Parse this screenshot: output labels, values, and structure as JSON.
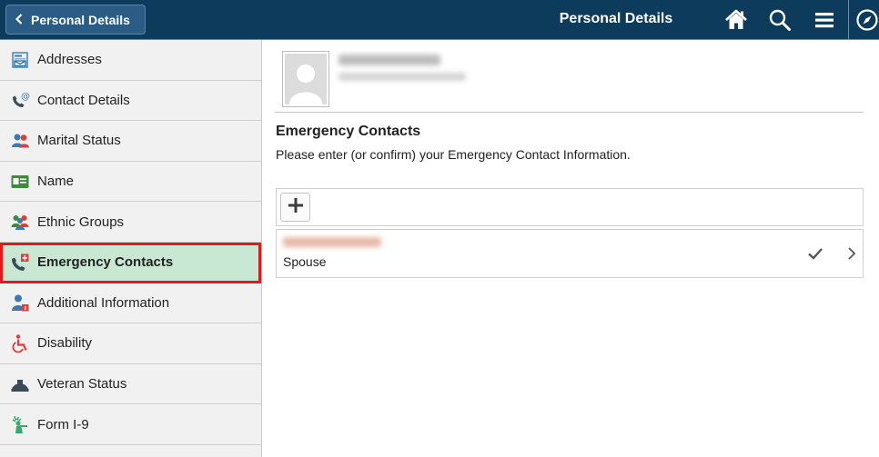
{
  "header": {
    "back_label": "Personal Details",
    "title": "Personal Details",
    "icons": [
      "home-icon",
      "search-icon",
      "menu-icon",
      "navbar-compass-icon"
    ],
    "bg_color": "#0d3b5c"
  },
  "sidebar": {
    "items": [
      {
        "label": "Addresses",
        "icon": "addresses-icon"
      },
      {
        "label": "Contact Details",
        "icon": "contact-details-icon"
      },
      {
        "label": "Marital Status",
        "icon": "marital-status-icon"
      },
      {
        "label": "Name",
        "icon": "name-card-icon"
      },
      {
        "label": "Ethnic Groups",
        "icon": "ethnic-groups-icon"
      },
      {
        "label": "Emergency Contacts",
        "icon": "emergency-contacts-icon",
        "active": true
      },
      {
        "label": "Additional Information",
        "icon": "additional-information-icon"
      },
      {
        "label": "Disability",
        "icon": "disability-icon"
      },
      {
        "label": "Veteran Status",
        "icon": "veteran-status-icon"
      },
      {
        "label": "Form I-9",
        "icon": "form-i9-icon"
      }
    ],
    "active_bg": "#c9e8d4",
    "highlight_color": "#e0191a"
  },
  "main": {
    "section_title": "Emergency Contacts",
    "section_subtitle": "Please enter (or confirm) your Emergency Contact Information.",
    "contacts": [
      {
        "relationship": "Spouse"
      }
    ]
  }
}
